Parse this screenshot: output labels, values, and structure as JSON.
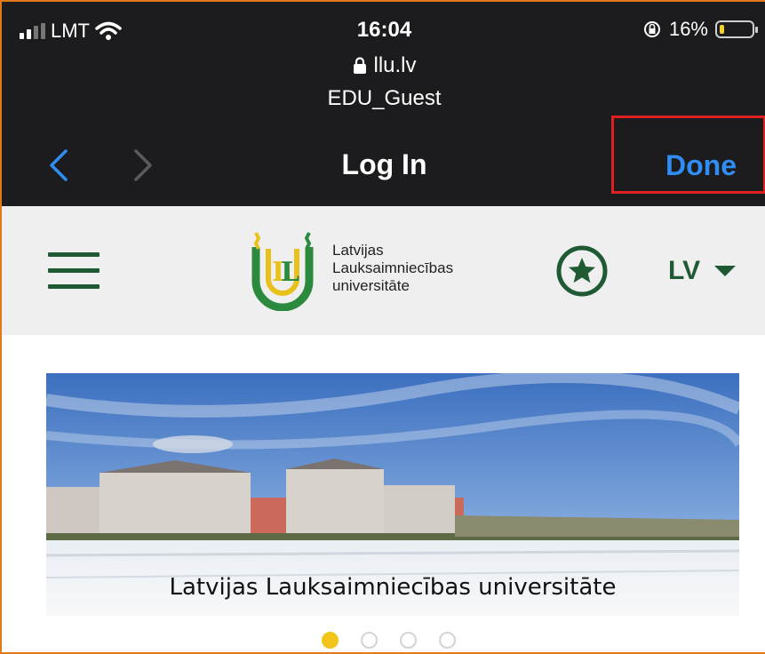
{
  "status_bar": {
    "carrier": "LMT",
    "time": "16:04",
    "battery_percent": "16%",
    "battery_level": 0.16,
    "battery_color": "#f6d12c"
  },
  "browser": {
    "url": "llu.lv",
    "network": "EDU_Guest",
    "title": "Log In",
    "done_label": "Done",
    "accent": "#2f8df5",
    "icons": {
      "back": "chevron-left-icon",
      "forward": "chevron-right-icon",
      "lock": "lock-icon"
    }
  },
  "site_header": {
    "logo_lines": [
      "Latvijas",
      "Lauksaimniecības",
      "universitāte"
    ],
    "language": "LV",
    "brand_color": "#1f5a35",
    "icons": {
      "menu": "hamburger-menu-icon",
      "favorite": "star-circle-icon",
      "dropdown": "caret-down-icon"
    }
  },
  "hero": {
    "caption": "Latvijas Lauksaimniecības universitāte",
    "carousel": {
      "count": 4,
      "active": 0,
      "active_color": "#f0c419"
    }
  }
}
